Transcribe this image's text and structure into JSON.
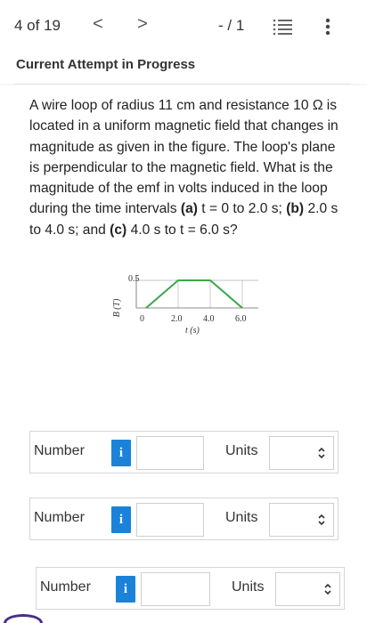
{
  "toolbar": {
    "page_count": "4 of 19",
    "prev_glyph": "<",
    "next_glyph": ">",
    "zoom": "- / 1",
    "icons": [
      "chevron-left-icon",
      "chevron-right-icon",
      "list-icon",
      "more-vertical-icon"
    ]
  },
  "section": {
    "title": "Current Attempt in Progress"
  },
  "question": {
    "p1": "A wire loop of radius 11 cm and resistance 10 Ω is located in a uniform magnetic field that changes in magnitude as given in the figure. The loop's plane is perpendicular to the magnetic field. What is the magnitude of the emf in volts induced in the loop during the time intervals ",
    "a_label": "(a)",
    "a_text": " t = 0 to 2.0 s; ",
    "b_label": "(b)",
    "b_text": " 2.0 s to 4.0 s; and ",
    "c_label": "(c)",
    "c_text": " 4.0 s to t = 6.0 s?"
  },
  "figure": {
    "y_tick": "0.5",
    "y_label": "B (T)",
    "origin": "0",
    "x_ticks": [
      "2.0",
      "4.0",
      "6.0"
    ],
    "x_label": "t (s)",
    "line_color": "#3aa84a",
    "x": [
      0,
      2,
      4,
      6
    ],
    "y": [
      0,
      0.5,
      0.5,
      0
    ]
  },
  "answers": [
    {
      "number_label": "Number",
      "info_glyph": "i",
      "units_label": "Units",
      "value": ""
    },
    {
      "number_label": "Number",
      "info_glyph": "i",
      "units_label": "Units",
      "value": ""
    },
    {
      "number_label": "Number",
      "info_glyph": "i",
      "units_label": "Units",
      "value": ""
    }
  ],
  "colors": {
    "info_button": "#1a83d9",
    "accent_purple": "#4a2b8c"
  }
}
